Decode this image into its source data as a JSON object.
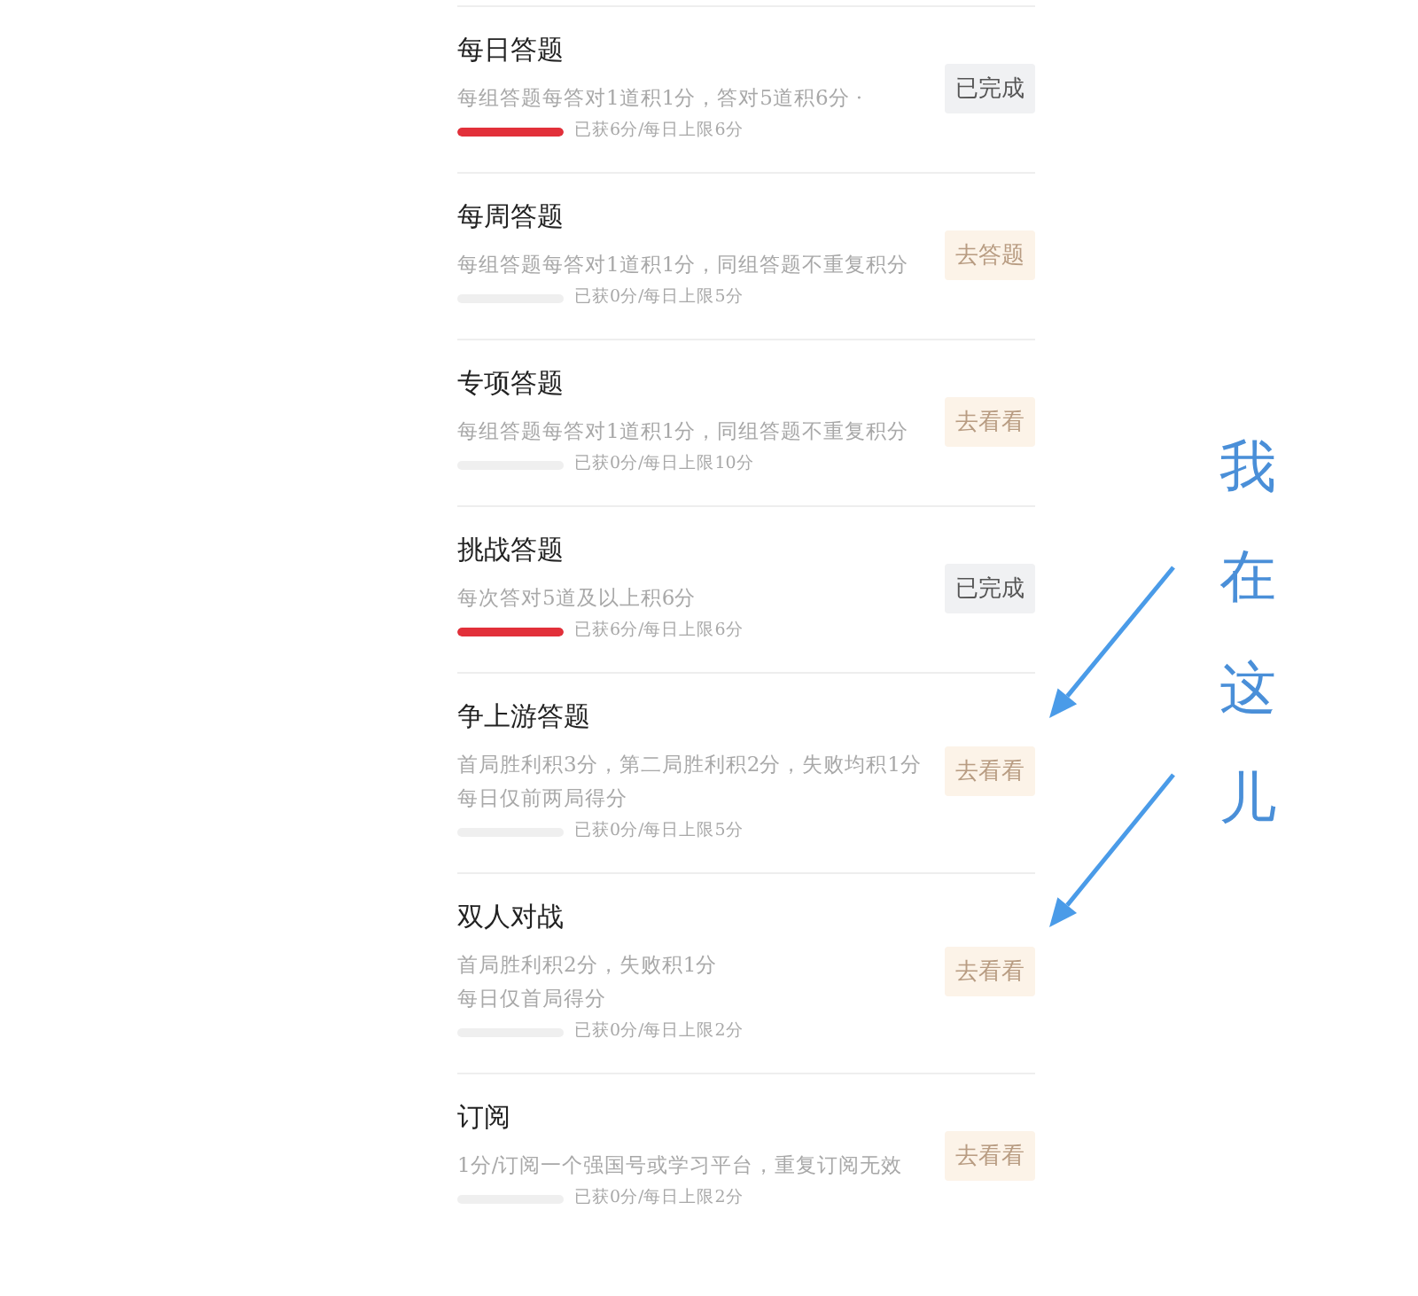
{
  "tasks": [
    {
      "title": "每日答题",
      "description": [
        "每组答题每答对1道积1分，答对5道积6分 ·"
      ],
      "level": 1,
      "progress_text": "已获6分/每日上限6分",
      "button": {
        "label": "已完成",
        "kind": "done"
      }
    },
    {
      "title": "每周答题",
      "description": [
        "每组答题每答对1道积1分，同组答题不重复积分"
      ],
      "level": 0,
      "progress_text": "已获0分/每日上限5分",
      "button": {
        "label": "去答题",
        "kind": "go"
      }
    },
    {
      "title": "专项答题",
      "description": [
        "每组答题每答对1道积1分，同组答题不重复积分"
      ],
      "level": 0,
      "progress_text": "已获0分/每日上限10分",
      "button": {
        "label": "去看看",
        "kind": "go"
      }
    },
    {
      "title": "挑战答题",
      "description": [
        "每次答对5道及以上积6分"
      ],
      "level": 1,
      "progress_text": "已获6分/每日上限6分",
      "button": {
        "label": "已完成",
        "kind": "done"
      }
    },
    {
      "title": "争上游答题",
      "description": [
        "首局胜利积3分，第二局胜利积2分，失败均积1分",
        "每日仅前两局得分"
      ],
      "level": 0,
      "progress_text": "已获0分/每日上限5分",
      "button": {
        "label": "去看看",
        "kind": "go"
      }
    },
    {
      "title": "双人对战",
      "description": [
        "首局胜利积2分，失败积1分",
        "每日仅首局得分"
      ],
      "level": 0,
      "progress_text": "已获0分/每日上限2分",
      "button": {
        "label": "去看看",
        "kind": "go"
      }
    },
    {
      "title": "订阅",
      "description": [
        "1分/订阅一个强国号或学习平台，重复订阅无效"
      ],
      "level": 0,
      "progress_text": "已获0分/每日上限2分",
      "button": {
        "label": "去看看",
        "kind": "go"
      }
    }
  ],
  "annotation": {
    "text": "我在这儿"
  }
}
